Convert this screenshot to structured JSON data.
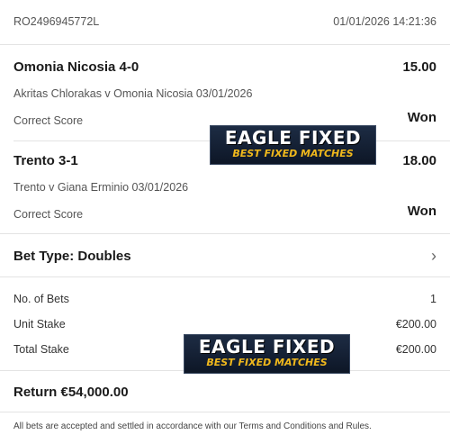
{
  "header": {
    "reference": "RO2496945772L",
    "datetime": "01/01/2026 14:21:36"
  },
  "selections": [
    {
      "title": "Omonia Nicosia 4-0",
      "odds": "15.00",
      "event": "Akritas Chlorakas v Omonia Nicosia 03/01/2026",
      "market": "Correct Score",
      "result": "Won"
    },
    {
      "title": "Trento 3-1",
      "odds": "18.00",
      "event": "Trento v Giana Erminio 03/01/2026",
      "market": "Correct Score",
      "result": "Won"
    }
  ],
  "bet_type": {
    "label": "Bet Type: Doubles",
    "icon": "chevron-right-icon"
  },
  "summary": [
    {
      "label": "No. of Bets",
      "value": "1"
    },
    {
      "label": "Unit Stake",
      "value": "€200.00"
    },
    {
      "label": "Total Stake",
      "value": "€200.00"
    }
  ],
  "return": {
    "label": "Return €54,000.00"
  },
  "footer": {
    "text": "All bets are accepted and settled in accordance with our Terms and Conditions and Rules."
  },
  "watermark": {
    "line1": "EAGLE FIXED",
    "line2": "BEST FIXED MATCHES",
    "accent": "#f0b81c",
    "bg": "#1d2c44"
  }
}
